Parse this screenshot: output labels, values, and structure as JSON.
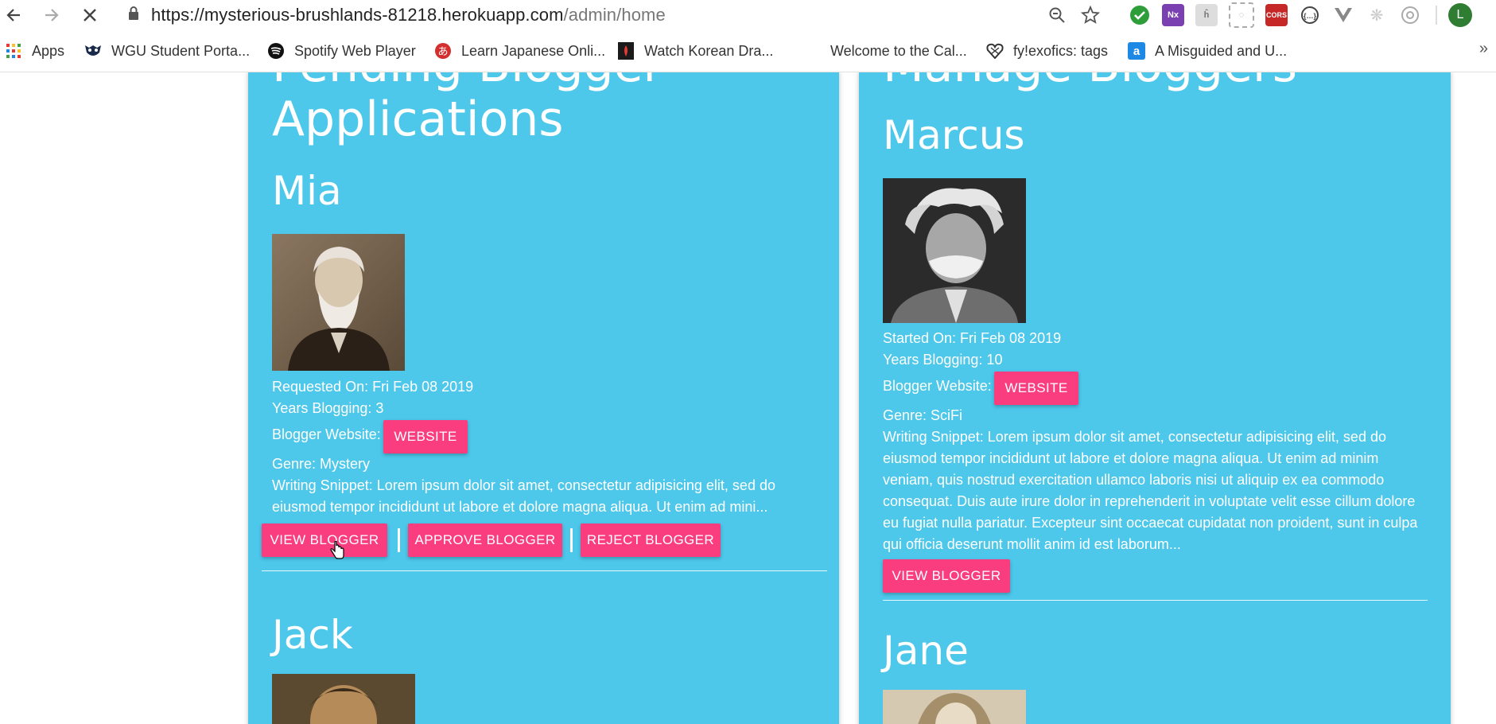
{
  "browser": {
    "url_main": "https://mysterious-brushlands-81218.herokuapp.com",
    "url_path": "/admin/home",
    "avatar_letter": "L",
    "extensions": [
      "search-zoom-icon",
      "star-icon",
      "green-check-icon",
      "onenote-icon",
      "extension-icon",
      "extension-icon",
      "cors-icon",
      "extension-icon",
      "vue-icon",
      "extension-icon",
      "extension-icon"
    ],
    "cors_label": "CORS",
    "nx_label": "Nx"
  },
  "bookmarks": [
    {
      "label": "Apps"
    },
    {
      "label": "WGU Student Porta..."
    },
    {
      "label": "Spotify Web Player"
    },
    {
      "label": "Learn Japanese Onli..."
    },
    {
      "label": "Watch Korean Dra..."
    },
    {
      "label": "Welcome to the Cal..."
    },
    {
      "label": "fy!exofics: tags"
    },
    {
      "label": "A Misguided and U..."
    }
  ],
  "left_panel": {
    "heading_top": "Pending Blogger",
    "heading_bottom": "Applications",
    "entries": [
      {
        "name": "Mia",
        "requested": "Requested On: Fri Feb 08 2019",
        "years": "Years Blogging: 3",
        "website_label": "Blogger Website:",
        "website_button": "WEBSITE",
        "genre": "Genre: Mystery",
        "snippet": "Writing Snippet: Lorem ipsum dolor sit amet, consectetur adipisicing elit, sed do eiusmod tempor incididunt ut labore et dolore magna aliqua. Ut enim ad mini...",
        "view_button": "VIEW BLOGGER",
        "approve_button": "APPROVE BLOGGER",
        "reject_button": "REJECT BLOGGER"
      },
      {
        "name": "Jack"
      }
    ]
  },
  "right_panel": {
    "heading": "Manage Bloggers",
    "entries": [
      {
        "name": "Marcus",
        "started": "Started On: Fri Feb 08 2019",
        "years": "Years Blogging: 10",
        "website_label": "Blogger Website:",
        "website_button": "WEBSITE",
        "genre": "Genre: SciFi",
        "snippet": "Writing Snippet: Lorem ipsum dolor sit amet, consectetur adipisicing elit, sed do eiusmod tempor incididunt ut labore et dolore magna aliqua. Ut enim ad minim veniam, quis nostrud exercitation ullamco laboris nisi ut aliquip ex ea commodo consequat. Duis aute irure dolor in reprehenderit in voluptate velit esse cillum dolore eu fugiat nulla pariatur. Excepteur sint occaecat cupidatat non proident, sunt in culpa qui officia deserunt mollit anim id est laborum...",
        "view_button": "VIEW BLOGGER"
      },
      {
        "name": "Jane"
      }
    ]
  },
  "colors": {
    "panel": "#4dc7ea",
    "button": "#f93d7f"
  }
}
